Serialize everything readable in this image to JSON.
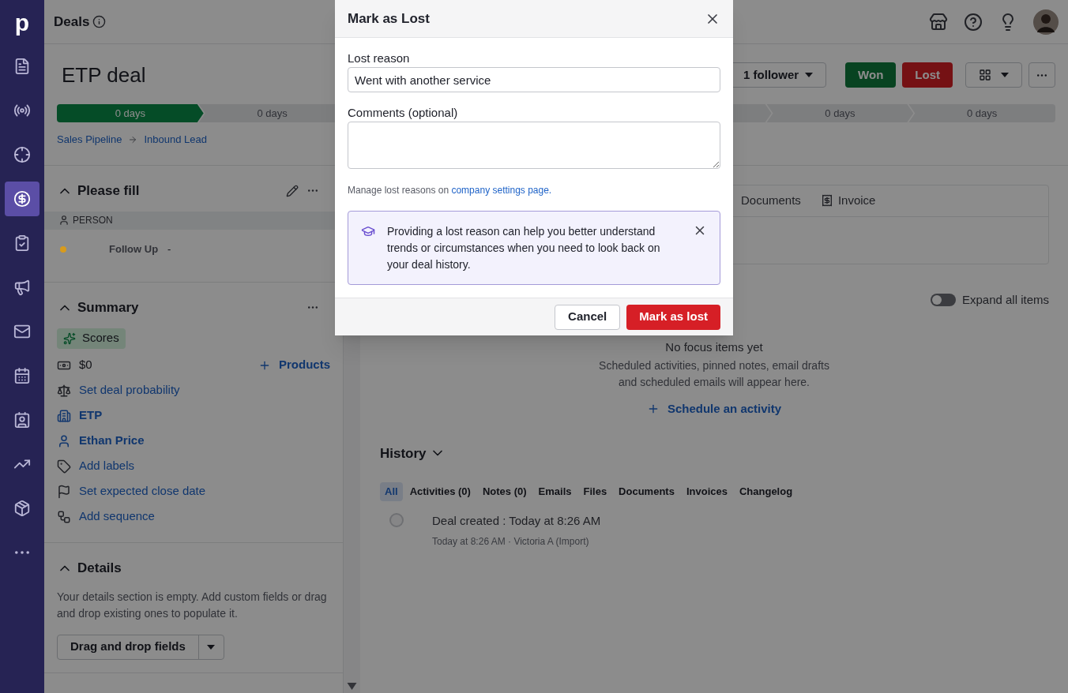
{
  "sidebar": {
    "logo": "p",
    "items": [
      {
        "selected": false
      },
      {
        "selected": false
      },
      {
        "selected": false
      },
      {
        "selected": true
      },
      {
        "selected": false
      },
      {
        "selected": false
      },
      {
        "selected": false
      },
      {
        "selected": false
      },
      {
        "selected": false
      },
      {
        "selected": false
      },
      {
        "selected": false
      },
      {
        "selected": false
      }
    ]
  },
  "topbar": {
    "title": "Deals"
  },
  "deal": {
    "title": "ETP deal",
    "follower_button": "1 follower",
    "won_button": "Won",
    "lost_button": "Lost"
  },
  "pipeline": {
    "stages": [
      {
        "label": "0 days",
        "selected": true
      },
      {
        "label": "0 days",
        "selected": false
      },
      {
        "selected": false
      },
      {
        "label": "0 days",
        "selected": false
      },
      {
        "label": "0 days",
        "selected": false
      }
    ],
    "breadcrumb": [
      "Sales Pipeline",
      "Inbound Lead"
    ]
  },
  "please_fill": {
    "title": "Please fill",
    "group": "PERSON",
    "fields": [
      {
        "label": "Follow Up",
        "value": "-",
        "color": "#d89b1c"
      }
    ]
  },
  "summary": {
    "title": "Summary",
    "scores": "Scores",
    "value": "$0",
    "products": "Products",
    "rows": [
      {
        "text": "Set deal probability",
        "kind": "action"
      },
      {
        "text": "ETP",
        "kind": "entity"
      },
      {
        "text": "Ethan Price",
        "kind": "entity"
      },
      {
        "text": "Add labels",
        "kind": "action"
      },
      {
        "text": "Set expected close date",
        "kind": "action"
      },
      {
        "text": "Add sequence",
        "kind": "action"
      }
    ]
  },
  "details": {
    "title": "Details",
    "text": "Your details section is empty. Add custom fields or drag and drop existing ones to populate it.",
    "button": "Drag and drop fields"
  },
  "tabs": [
    {
      "label": "Documents"
    },
    {
      "label": "Invoice"
    }
  ],
  "focus": {
    "expand_toggle": {
      "label": "Expand all items",
      "on": false
    },
    "empty_title": "No focus items yet",
    "empty_text": "Scheduled activities, pinned notes, email drafts and scheduled emails will appear here.",
    "action": "Schedule an activity"
  },
  "history": {
    "title": "History",
    "filters": [
      {
        "label": "All",
        "selected": true
      },
      {
        "label": "Activities (0)",
        "selected": false
      },
      {
        "label": "Notes (0)",
        "selected": false
      },
      {
        "label": "Emails",
        "selected": false
      },
      {
        "label": "Files",
        "selected": false
      },
      {
        "label": "Documents",
        "selected": false
      },
      {
        "label": "Invoices",
        "selected": false
      },
      {
        "label": "Changelog",
        "selected": false
      }
    ],
    "items": [
      {
        "title": "Deal created : Today at 8:26 AM",
        "meta": "Today at 8:26 AM · Victoria A (Import)"
      }
    ]
  },
  "modal": {
    "title": "Mark as Lost",
    "lost_reason": {
      "label": "Lost reason",
      "value": "Went with another service"
    },
    "comments": {
      "label": "Comments (optional)"
    },
    "manage_text": "Manage lost reasons on",
    "manage_link": "company settings page.",
    "tip": "Providing a lost reason can help you better understand trends or circumstances when you need to look back on your deal history.",
    "cancel_button": "Cancel",
    "confirm_button": "Mark as lost"
  }
}
